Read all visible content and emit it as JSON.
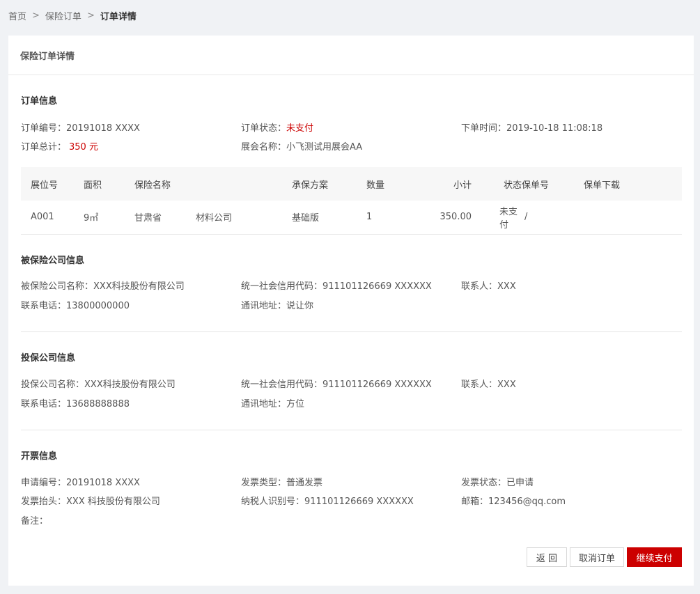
{
  "breadcrumb": {
    "home": "首页",
    "orders": "保险订单",
    "current": "订单详情",
    "sep": ">"
  },
  "card_title": "保险订单详情",
  "order_info": {
    "title": "订单信息",
    "order_no_label": "订单编号：",
    "order_no": "20191018 XXXX",
    "status_label": "订单状态：",
    "status": "未支付",
    "time_label": "下单时间：",
    "time": "2019-10-18 11:08:18",
    "total_label": "订单总计：",
    "total": "350 元",
    "expo_label": "展会名称：",
    "expo": "小飞测试用展会AA"
  },
  "table": {
    "headers": [
      "展位号",
      "面积",
      "保险名称",
      "承保方案",
      "数量",
      "小计",
      "状态",
      "保单号",
      "保单下载"
    ],
    "row": {
      "booth": "A001",
      "area": "9㎡",
      "province": "甘肃省",
      "insurance": "材料公司",
      "plan": "基础版",
      "qty": "1",
      "subtotal": "350.00",
      "status": "未支付",
      "policy_no": "/"
    }
  },
  "insured": {
    "title": "被保险公司信息",
    "name_label": "被保险公司名称：",
    "name": "XXX科技股份有限公司",
    "credit_label": "统一社会信用代码：",
    "credit": "911101126669 XXXXXX",
    "contact_label": "联系人：",
    "contact": "XXX",
    "phone_label": "联系电话：",
    "phone": "13800000000",
    "address_label": "通讯地址：",
    "address": "说让你"
  },
  "policyholder": {
    "title": "投保公司信息",
    "name_label": "投保公司名称：",
    "name": "XXX科技股份有限公司",
    "credit_label": "统一社会信用代码：",
    "credit": "911101126669 XXXXXX",
    "contact_label": "联系人：",
    "contact": "XXX",
    "phone_label": "联系电话：",
    "phone": "13688888888",
    "address_label": "通讯地址：",
    "address": "方位"
  },
  "invoice": {
    "title": "开票信息",
    "apply_no_label": "申请编号：",
    "apply_no": "20191018 XXXX",
    "type_label": "发票类型：",
    "type": "普通发票",
    "status_label": "发票状态：",
    "status": "已申请",
    "header_label": "发票抬头：",
    "header": "XXX 科技股份有限公司",
    "tax_label": "纳税人识别号：",
    "tax": "911101126669 XXXXXX",
    "email_label": "邮箱：",
    "email": "123456@qq.com",
    "remark_label": "备注："
  },
  "buttons": {
    "back": "返 回",
    "cancel": "取消订单",
    "pay": "继续支付"
  },
  "colors": {
    "accent": "#cc0000",
    "background": "#f0f2f5"
  }
}
